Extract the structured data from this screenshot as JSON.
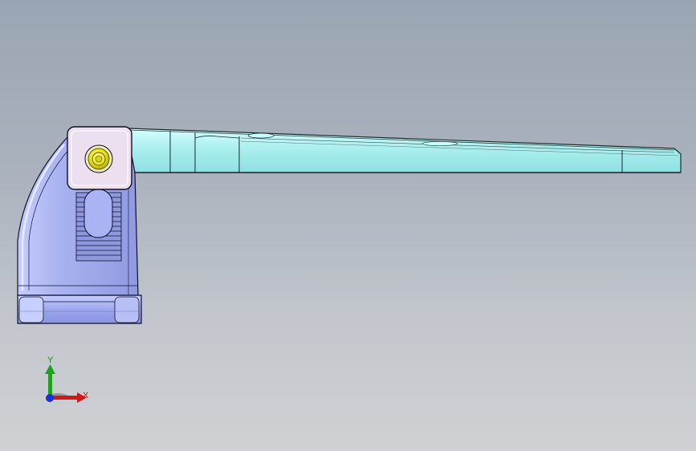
{
  "viewport": {
    "background_top": "#9aa5b3",
    "background_bottom": "#cfd1d4",
    "view_orientation": "front"
  },
  "model": {
    "arm_color": "#aef0f0",
    "arm_edge_color": "#1a2a2a",
    "bracket_color": "#a9b2f0",
    "bracket_highlight_color": "#dde2ff",
    "hinge_block_color": "#ecdff0",
    "screw_color": "#e8e820",
    "screw_ring_color": "#b8a800"
  },
  "triad": {
    "x_label": "X",
    "y_label": "Y",
    "x_color": "#d01818",
    "y_color": "#20a020",
    "z_color": "#2030d0"
  }
}
